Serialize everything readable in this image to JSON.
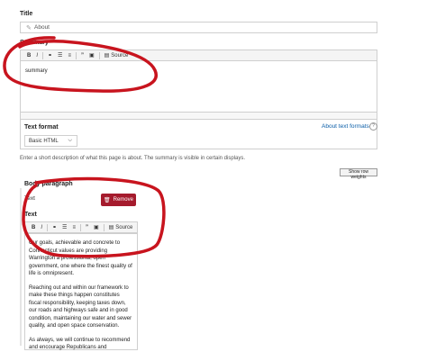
{
  "title_field": {
    "label": "Title",
    "value": "About"
  },
  "summary_field": {
    "label": "Summary",
    "toolbar": [
      "B",
      "I",
      "link",
      "unlink",
      "bulleted-list",
      "numbered-list",
      "blockquote",
      "image",
      "Source"
    ],
    "source_label": "Source",
    "content": "summary"
  },
  "text_format": {
    "label": "Text format",
    "selected": "Basic HTML",
    "help_link": "About text formats",
    "help_icon": "?"
  },
  "summary_help": "Enter a short description of what this page is about. The summary is visible in certain displays.",
  "row_weights_button": "Show row weights",
  "body_paragraph": {
    "label": "Body paragraph",
    "type_label": "Text",
    "remove_button": "Remove",
    "text_label": "Text",
    "source_label": "Source",
    "paragraphs": [
      "Our goals, achievable and concrete to Connecticut values are providing Warrington a professional, open government, one where the finest quality of life is omnipresent.",
      "Reaching out and within our framework to make these things happen constitutes fiscal responsibility, keeping taxes down, our roads and highways safe and in good condition, maintaining our water and sewer quality, and open space conservation.",
      "As always, we will continue to recommend and encourage Republicans and"
    ]
  },
  "colors": {
    "annotation": "#c8141e",
    "remove_button": "#a51b2d",
    "link": "#0b5ea8"
  }
}
